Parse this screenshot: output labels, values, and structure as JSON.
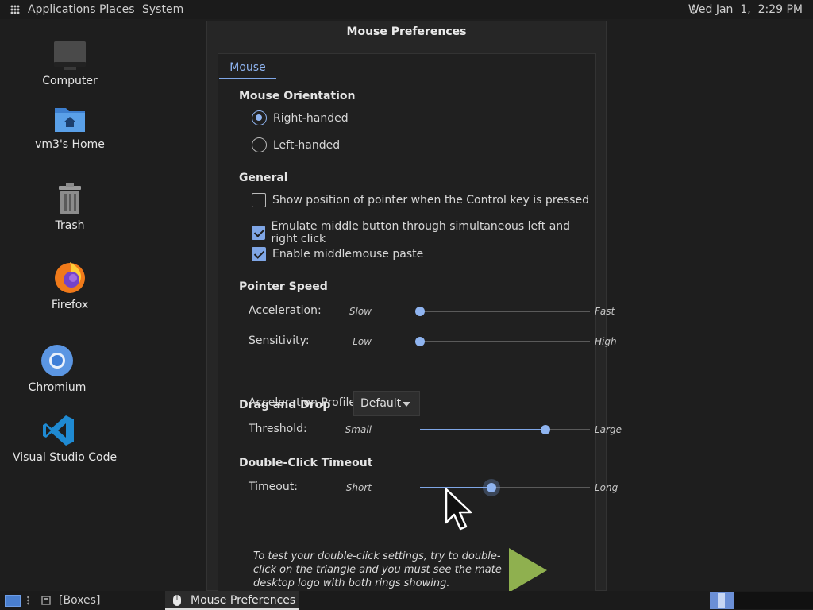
{
  "top_panel": {
    "menus": [
      "Applications",
      "Places",
      "System"
    ],
    "clock": "Wed Jan  1,  2:29 PM"
  },
  "desktop": {
    "icons": [
      {
        "label": "Computer"
      },
      {
        "label": "vm3's Home"
      },
      {
        "label": "Trash"
      },
      {
        "label": "Firefox"
      },
      {
        "label": "Chromium"
      },
      {
        "label": "Visual Studio Code"
      }
    ]
  },
  "window": {
    "title": "Mouse Preferences",
    "tab": "Mouse",
    "orientation": {
      "heading": "Mouse Orientation",
      "options": [
        "Right-handed",
        "Left-handed"
      ],
      "selected": "Right-handed"
    },
    "general": {
      "heading": "General",
      "options": [
        {
          "label": "Show position of pointer when the Control key is pressed",
          "checked": false
        },
        {
          "label": "Emulate middle button through simultaneous left and right click",
          "checked": true
        },
        {
          "label": "Enable middlemouse paste",
          "checked": true
        }
      ]
    },
    "pointer_speed": {
      "heading": "Pointer Speed",
      "acceleration": {
        "label": "Acceleration:",
        "low": "Slow",
        "high": "Fast",
        "value": 0.0
      },
      "sensitivity": {
        "label": "Sensitivity:",
        "low": "Low",
        "high": "High",
        "value": 0.0
      },
      "profile": {
        "label": "Acceleration Profile:",
        "value": "Default"
      }
    },
    "drag_drop": {
      "heading": "Drag and Drop",
      "threshold": {
        "label": "Threshold:",
        "low": "Small",
        "high": "Large",
        "value": 0.74
      }
    },
    "double_click": {
      "heading": "Double-Click Timeout",
      "timeout": {
        "label": "Timeout:",
        "low": "Short",
        "high": "Long",
        "value": 0.42
      },
      "test_text": "To test your double-click settings, try to double-click on the triangle and you must see the mate desktop logo with both rings showing."
    }
  },
  "bottom_panel": {
    "boxes": "[Boxes]",
    "task": "Mouse Preferences"
  },
  "colors": {
    "accent": "#7fa6e6",
    "triangle": "#8fb04f"
  }
}
